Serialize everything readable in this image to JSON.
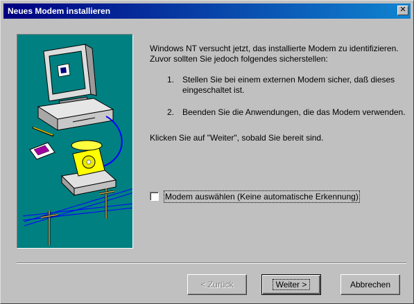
{
  "window": {
    "title": "Neues Modem installieren",
    "close_glyph": "✕"
  },
  "content": {
    "intro": "Windows NT versucht jetzt, das installierte Modem zu identifizieren. Zuvor sollten Sie jedoch folgendes sicherstellen:",
    "steps": [
      {
        "number": "1.",
        "text": "Stellen Sie bei einem externen Modem sicher, daß dieses eingeschaltet ist."
      },
      {
        "number": "2.",
        "text": "Beenden Sie die Anwendungen, die das Modem verwenden."
      }
    ],
    "instruction": "Klicken Sie auf \"Weiter\", sobald Sie bereit sind."
  },
  "checkbox": {
    "label": "Modem auswählen (Keine automatische Erkennung)",
    "checked": false
  },
  "buttons": {
    "back": "< Zurück",
    "next": "Weiter >",
    "cancel": "Abbrechen"
  },
  "colors": {
    "titlebar_start": "#000080",
    "titlebar_end": "#1084d0",
    "illustration_bg": "#008080",
    "dialog_bg": "#c0c0c0"
  }
}
